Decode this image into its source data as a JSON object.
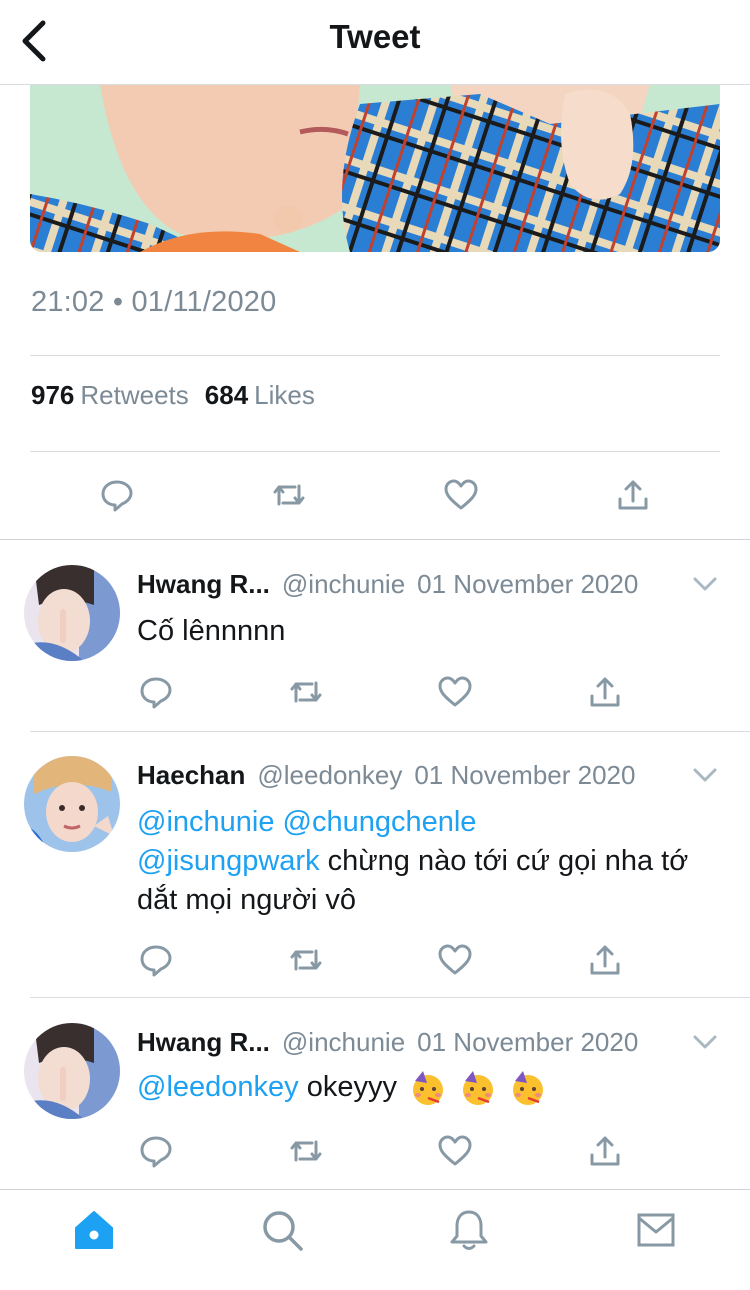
{
  "header": {
    "title": "Tweet",
    "back_icon": "chevron-left-icon"
  },
  "tweet": {
    "timestamp": "21:02 • 01/11/2020",
    "retweets_count": "976",
    "retweets_label": "Retweets",
    "likes_count": "684",
    "likes_label": "Likes"
  },
  "replies": [
    {
      "name": "Hwang R...",
      "handle": "@inchunie",
      "date": "01 November 2020",
      "text": "Cố lênnnnn"
    },
    {
      "name": "Haechan",
      "handle": "@leedonkey",
      "date": "01 November 2020",
      "mention1": "@inchunie",
      "mention2": "@chungchenle",
      "mention3": "@jisungpwark",
      "text": " chừng nào tới cứ gọi nha tớ dắt mọi người vô"
    },
    {
      "name": "Hwang R...",
      "handle": "@inchunie",
      "date": "01 November 2020",
      "mention1": "@leedonkey",
      "text": "okeyyy",
      "emoji": "partying-face-emoji"
    }
  ],
  "colors": {
    "accent": "#1da1f2",
    "secondary_text": "#7c8a96",
    "icon_gray": "#8899a6"
  },
  "tabbar": {
    "items": [
      "home-icon",
      "search-icon",
      "notifications-icon",
      "messages-icon"
    ]
  }
}
